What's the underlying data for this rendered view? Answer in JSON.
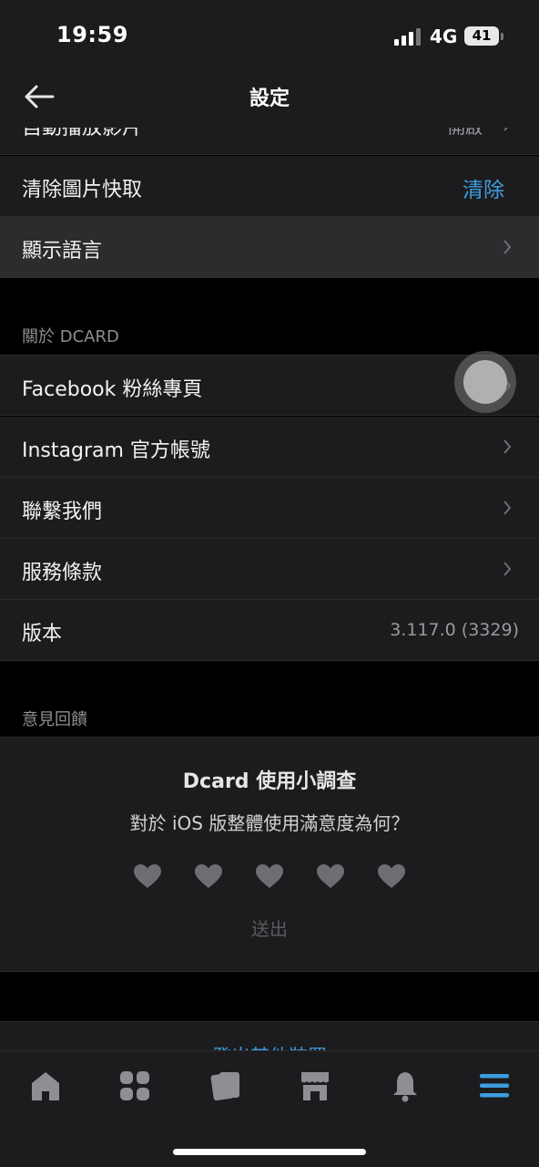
{
  "status_bar": {
    "time": "19:59",
    "network": "4G",
    "battery": "41"
  },
  "nav": {
    "title": "設定"
  },
  "rows_top": [
    {
      "label": "自動播放影片",
      "value": "開啟"
    },
    {
      "label": "清除圖片快取",
      "action": "清除"
    },
    {
      "label": "顯示語言"
    }
  ],
  "sections": {
    "about": {
      "header": "關於 DCARD",
      "items": [
        {
          "label": "Facebook 粉絲專頁"
        },
        {
          "label": "Instagram 官方帳號"
        },
        {
          "label": "聯繫我們"
        },
        {
          "label": "服務條款"
        },
        {
          "label": "版本",
          "value": "3.117.0 (3329)"
        }
      ]
    },
    "feedback": {
      "header": "意見回饋"
    }
  },
  "survey": {
    "title": "Dcard 使用小調查",
    "question": "對於 iOS 版整體使用滿意度為何？",
    "rating_max": 5,
    "rating_selected": 0,
    "submit_label": "送出"
  },
  "more": {
    "label": "登出其他裝置"
  },
  "tab_bar": {
    "items": [
      "home-icon",
      "grid-icon",
      "cards-icon",
      "shop-icon",
      "bell-icon",
      "menu-icon"
    ],
    "active_color": "#3d9de0",
    "inactive_color": "#8e8e93"
  }
}
